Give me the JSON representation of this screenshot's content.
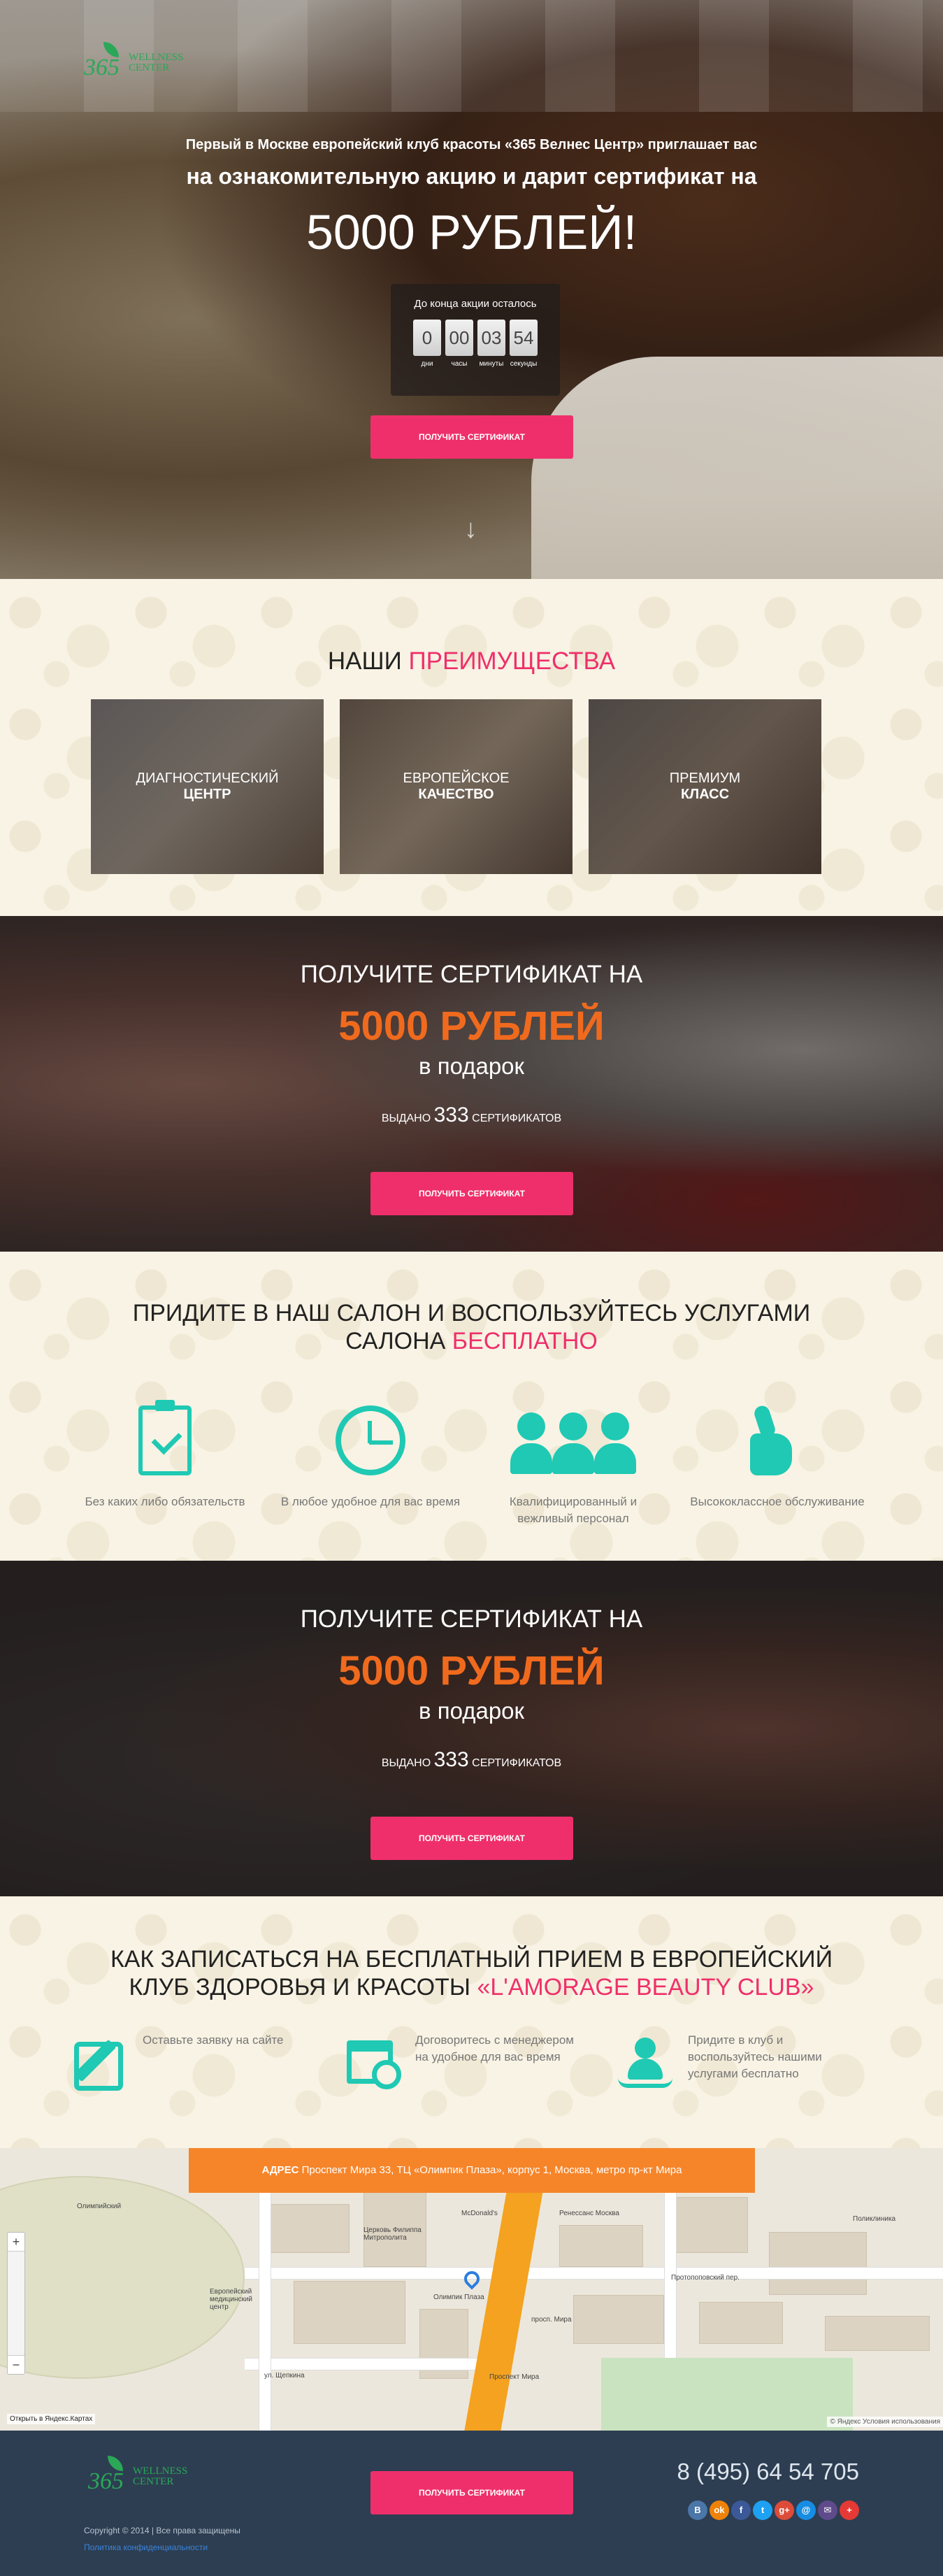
{
  "brand": {
    "logo_number": "365",
    "logo_line1": "Wellness",
    "logo_line2": "Center"
  },
  "hero": {
    "subtitle1": "Первый в Москве европейский клуб красоты «365 Велнес Центр» приглашает вас",
    "subtitle2": "на ознакомительную акцию и дарит сертификат на",
    "amount": "5000 РУБЛЕЙ!",
    "timer": {
      "title": "До конца акции осталось",
      "cells": [
        {
          "value": "0",
          "label": "дни"
        },
        {
          "value": "00",
          "label": "часы"
        },
        {
          "value": "03",
          "label": "минуты"
        },
        {
          "value": "54",
          "label": "секунды"
        }
      ]
    },
    "button": "Получить сертификат",
    "scroll_arrow": "↓"
  },
  "advantages": {
    "title_plain": "НАШИ",
    "title_accent": "ПРЕИМУЩЕСТВА",
    "cards": [
      {
        "line1": "ДИАГНОСТИЧЕСКИЙ",
        "line2": "ЦЕНТР"
      },
      {
        "line1": "ЕВРОПЕЙСКОЕ",
        "line2": "КАЧЕСТВО"
      },
      {
        "line1": "ПРЕМИУМ",
        "line2": "КЛАСС"
      }
    ]
  },
  "certificate": {
    "line1": "ПОЛУЧИТЕ СЕРТИФИКАТ НА",
    "amount": "5000 РУБЛЕЙ",
    "gift": "в подарок",
    "issued_prefix": "ВЫДАНО",
    "issued_count": "333",
    "issued_suffix": "СЕРТИФИКАТОВ",
    "button": "Получить сертификат"
  },
  "free_services": {
    "title_line1": "ПРИДИТЕ В НАШ САЛОН И ВОСПОЛЬЗУЙТЕСЬ УСЛУГАМИ",
    "title_line2_plain": "САЛОНА",
    "title_line2_accent": "БЕСПЛАТНО",
    "features": [
      {
        "icon": "clipboard-check-icon",
        "text": "Без каких либо обязательств"
      },
      {
        "icon": "clock-icon",
        "text": "В любое удобное для вас время"
      },
      {
        "icon": "team-icon",
        "text": "Квалифицированный и вежливый персонал"
      },
      {
        "icon": "thumbs-up-icon",
        "text": "Высококлассное обслуживание"
      }
    ]
  },
  "how_to": {
    "title_line1": "КАК ЗАПИСАТЬСЯ НА БЕСПЛАТНЫЙ ПРИЕМ В ЕВРОПЕЙСКИЙ",
    "title_line2_plain": "КЛУБ ЗДОРОВЬЯ И КРАСОТЫ",
    "title_line2_accent": "«L'AMORAGE BEAUTY CLUB»",
    "steps": [
      {
        "icon": "edit-icon",
        "text": "Оставьте заявку на сайте"
      },
      {
        "icon": "calendar-clock-icon",
        "text": "Договоритесь с менеджером на удобное для вас время"
      },
      {
        "icon": "spa-icon",
        "text": "Придите в клуб и воспользуйтесь нашими услугами бесплатно"
      }
    ]
  },
  "map": {
    "address_label": "АДРЕС",
    "address": "Проспект Мира 33, ТЦ «Олимпик Плаза», корпус 1, Москва, метро пр-кт Мира",
    "zoom_in": "+",
    "zoom_out": "−",
    "open_link": "Открыть в Яндекс.Картах",
    "terms": "© Яндекс  Условия использования",
    "labels": {
      "stadium": "Олимпийский",
      "center": "Европейский медицинский центр",
      "street1": "ул. Щепкина",
      "street2": "просп. Мира",
      "street3": "Протопоповский пер.",
      "church": "Церковь Филиппа Митрополита",
      "mcd": "McDonald's",
      "hotel": "Ренессанс Москва",
      "mall": "Олимпик Плаза",
      "metro": "Проспект Мира",
      "polyclinic": "Поликлиника"
    }
  },
  "footer": {
    "logo_number": "365",
    "logo_line1": "Wellness",
    "logo_line2": "Center",
    "copyright": "Copyright © 2014 | Все права защищены",
    "privacy": "Политика конфиденциальности",
    "button": "Получить сертификат",
    "phone": "8 (495) 64 54 705",
    "socials": [
      {
        "icon": "vk-icon",
        "glyph": "B",
        "color": "#4a76a8"
      },
      {
        "icon": "odnoklassniki-icon",
        "glyph": "ok",
        "color": "#ee8208"
      },
      {
        "icon": "facebook-icon",
        "glyph": "f",
        "color": "#3b5998"
      },
      {
        "icon": "twitter-icon",
        "glyph": "t",
        "color": "#1da1f2"
      },
      {
        "icon": "google-plus-icon",
        "glyph": "g+",
        "color": "#dd4b39"
      },
      {
        "icon": "mail-ru-icon",
        "glyph": "@",
        "color": "#168de2"
      },
      {
        "icon": "email-icon",
        "glyph": "✉",
        "color": "#5f4b8b"
      },
      {
        "icon": "more-icon",
        "glyph": "+",
        "color": "#e53935"
      }
    ]
  }
}
